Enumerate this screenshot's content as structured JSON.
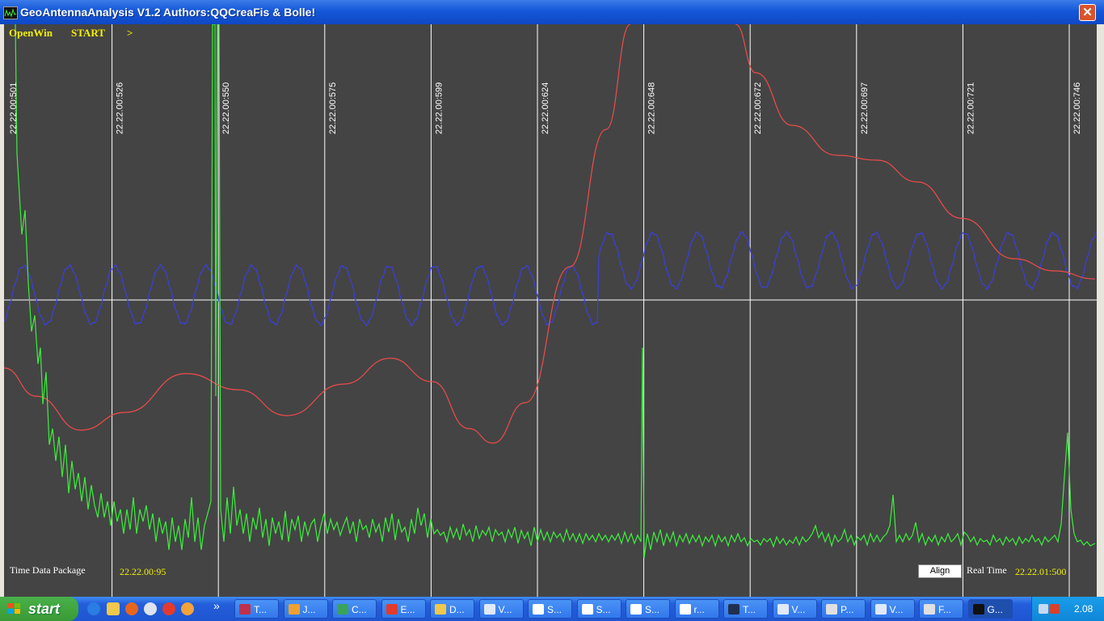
{
  "window": {
    "title": "GeoAntennaAnalysis V1.2 Authors:QQCreaFis & Bolle!",
    "close_glyph": "✕"
  },
  "toolbar": {
    "openwin": "OpenWin",
    "start": "START",
    "next": ">"
  },
  "plot": {
    "time_markers": [
      "22.22.00:501",
      "22.22.00:526",
      "22.22.00:550",
      "22.22.00:575",
      "22.22.00:599",
      "22.22.00:624",
      "22.22.00:648",
      "22.22.00:672",
      "22.22.00:697",
      "22.22.00:721",
      "22.22.00:746"
    ],
    "bottom_left_label": "Time Data Package",
    "bottom_left_value": "22.22.00:95",
    "align_button": "Align",
    "realtime_label": "Real Time",
    "realtime_value": "22.22.01:500",
    "colors": {
      "background": "#444444",
      "grid": "#ffffff",
      "label_yellow": "#f2f000",
      "green_trace": "#3cf03c",
      "blue_trace": "#3b3fe0",
      "red_trace": "#f04b4b"
    },
    "progress": 0.043
  },
  "taskbar": {
    "start_label": "start",
    "overflow": "»",
    "tasks": [
      {
        "label": "T...",
        "icon": "floppy-icon"
      },
      {
        "label": "J...",
        "icon": "paint-icon"
      },
      {
        "label": "C...",
        "icon": "wireless-icon"
      },
      {
        "label": "E...",
        "icon": "chrome-icon"
      },
      {
        "label": "D...",
        "icon": "folder-icon"
      },
      {
        "label": "V...",
        "icon": "window-icon"
      },
      {
        "label": "S...",
        "icon": "doc-icon"
      },
      {
        "label": "S...",
        "icon": "doc-icon"
      },
      {
        "label": "S...",
        "icon": "doc-icon"
      },
      {
        "label": "r...",
        "icon": "doc-icon"
      },
      {
        "label": "T...",
        "icon": "terminal-icon"
      },
      {
        "label": "V...",
        "icon": "window-icon"
      },
      {
        "label": "P...",
        "icon": "pen-icon"
      },
      {
        "label": "V...",
        "icon": "window-icon"
      },
      {
        "label": "F...",
        "icon": "pen-icon"
      },
      {
        "label": "G...",
        "icon": "app-graph-icon"
      }
    ],
    "clock": "2.08"
  }
}
